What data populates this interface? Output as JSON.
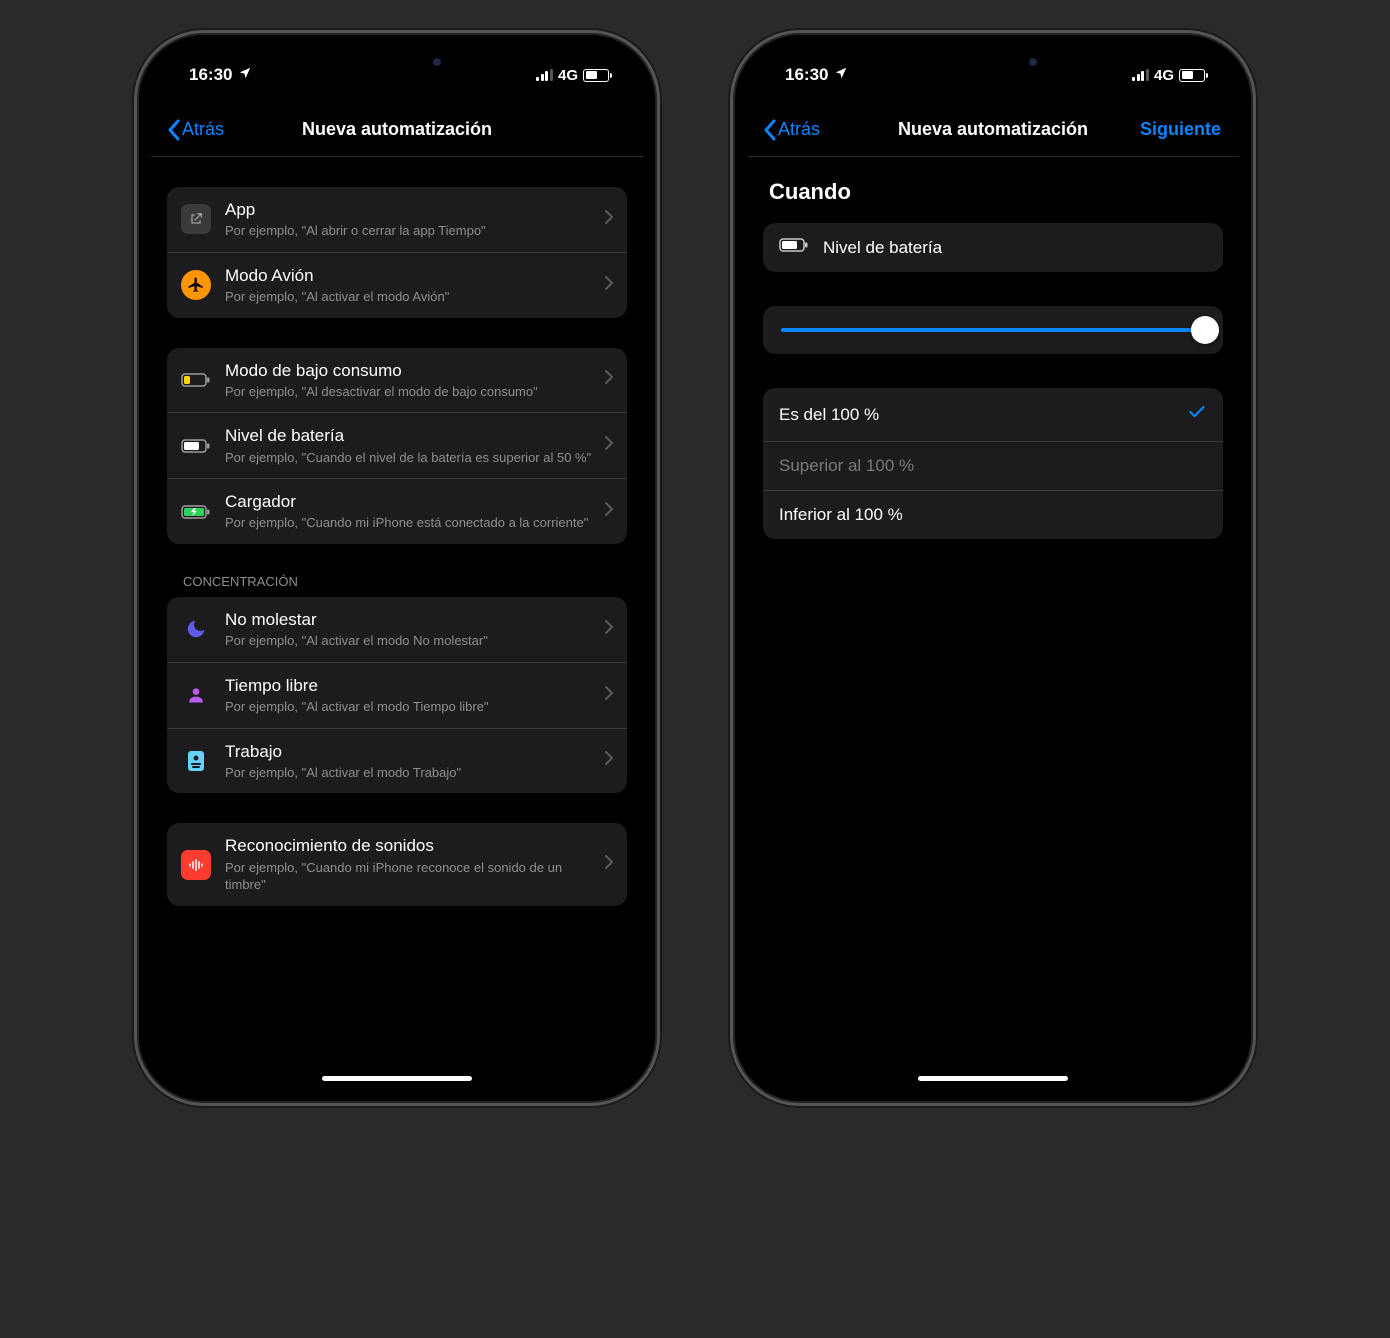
{
  "status": {
    "time": "16:30",
    "network": "4G"
  },
  "left": {
    "back": "Atrás",
    "title": "Nueva automatización",
    "groups": [
      {
        "rows": [
          {
            "title": "App",
            "sub": "Por ejemplo, \"Al abrir o cerrar la app Tiempo\""
          },
          {
            "title": "Modo Avión",
            "sub": "Por ejemplo, \"Al activar el modo Avión\""
          }
        ]
      },
      {
        "rows": [
          {
            "title": "Modo de bajo consumo",
            "sub": "Por ejemplo, \"Al desactivar el modo de bajo consumo\""
          },
          {
            "title": "Nivel de batería",
            "sub": "Por ejemplo, \"Cuando el nivel de la batería es superior al 50 %\""
          },
          {
            "title": "Cargador",
            "sub": "Por ejemplo, \"Cuando mi iPhone está conectado a la corriente\""
          }
        ]
      },
      {
        "header": "CONCENTRACIÓN",
        "rows": [
          {
            "title": "No molestar",
            "sub": "Por ejemplo, \"Al activar el modo No molestar\""
          },
          {
            "title": "Tiempo libre",
            "sub": "Por ejemplo, \"Al activar el modo Tiempo libre\""
          },
          {
            "title": "Trabajo",
            "sub": "Por ejemplo, \"Al activar el modo Trabajo\""
          }
        ]
      },
      {
        "rows": [
          {
            "title": "Reconocimiento de sonidos",
            "sub": "Por ejemplo, \"Cuando mi iPhone reconoce el sonido de un timbre\""
          }
        ]
      }
    ]
  },
  "right": {
    "back": "Atrás",
    "title": "Nueva automatización",
    "next": "Siguiente",
    "heading": "Cuando",
    "trigger": "Nivel de batería",
    "slider_percent": 100,
    "options": [
      {
        "label": "Es del 100 %",
        "selected": true,
        "dim": false
      },
      {
        "label": "Superior al 100 %",
        "selected": false,
        "dim": true
      },
      {
        "label": "Inferior al 100 %",
        "selected": false,
        "dim": false
      }
    ]
  }
}
